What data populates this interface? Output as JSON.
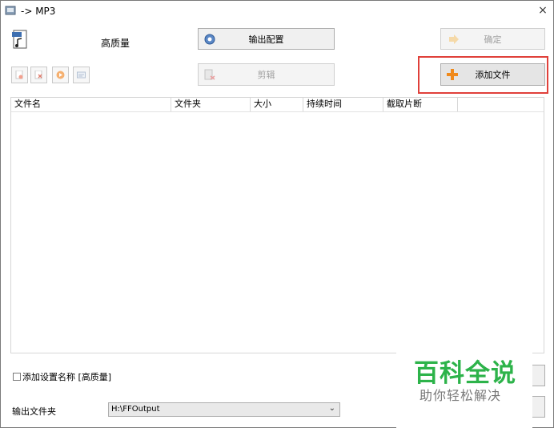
{
  "window": {
    "title": "-> MP3",
    "close_glyph": "×"
  },
  "profile": {
    "quality_label": "高质量"
  },
  "buttons": {
    "output_config": "输出配置",
    "ok": "确定",
    "clip": "剪辑",
    "add_files": "添加文件"
  },
  "file_table": {
    "columns": [
      "文件名",
      "文件夹",
      "大小",
      "持续时间",
      "截取片断"
    ],
    "rows": []
  },
  "options": {
    "add_setting_name": "添加设置名称 [高质量]"
  },
  "output": {
    "folder_label": "输出文件夹",
    "folder_value": "H:\\FFOutput"
  },
  "watermark": {
    "title": "百科全说",
    "subtitle": "助你轻松解决"
  },
  "colors": {
    "highlight": "#e0403a",
    "watermark_green": "#2db34a",
    "add_icon": "#f08a1c"
  }
}
